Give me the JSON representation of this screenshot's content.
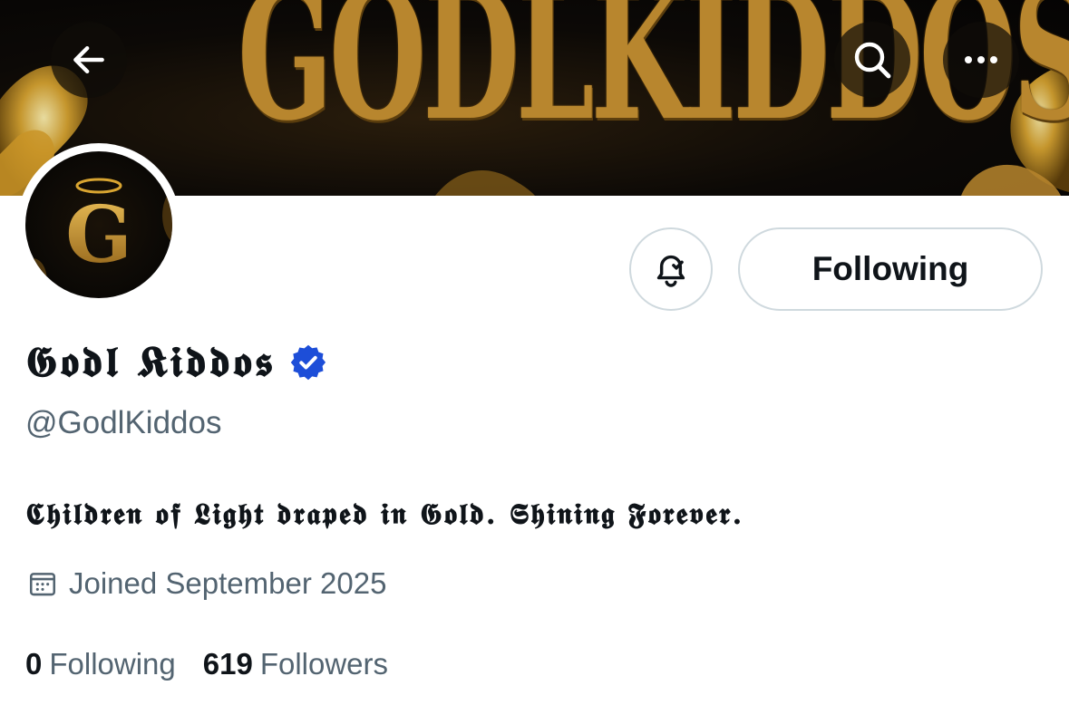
{
  "banner": {
    "text": "GODLKIDDOS"
  },
  "nav": {
    "back_icon": "arrow-left-icon",
    "search_icon": "search-icon",
    "more_icon": "more-horizontal-icon"
  },
  "profile": {
    "avatar_letter": "G",
    "display_name": "𝕲𝖔𝖉𝖑 𝕶𝖎𝖉𝖉𝖔𝖘",
    "handle": "@GodlKiddos",
    "bio": "𝕮𝖍𝖎𝖑𝖉𝖗𝖊𝖓 𝖔𝖋 𝕷𝖎𝖌𝖍𝖙 𝖉𝖗𝖆𝖕𝖊𝖉 𝖎𝖓 𝕲𝖔𝖑𝖉. 𝕾𝖍𝖎𝖓𝖎𝖓𝖌 𝕱𝖔𝖗𝖊𝖛𝖊𝖗.",
    "joined": "Joined September 2025",
    "verified_color": "#1d4ed8"
  },
  "actions": {
    "notifications_icon": "bell-check-icon",
    "follow_label": "Following"
  },
  "stats": {
    "following_count": "0",
    "following_label": "Following",
    "followers_count": "619",
    "followers_label": "Followers"
  },
  "colors": {
    "gold": "#b8862e",
    "secondary_text": "#536471",
    "border": "#cfd9de"
  }
}
